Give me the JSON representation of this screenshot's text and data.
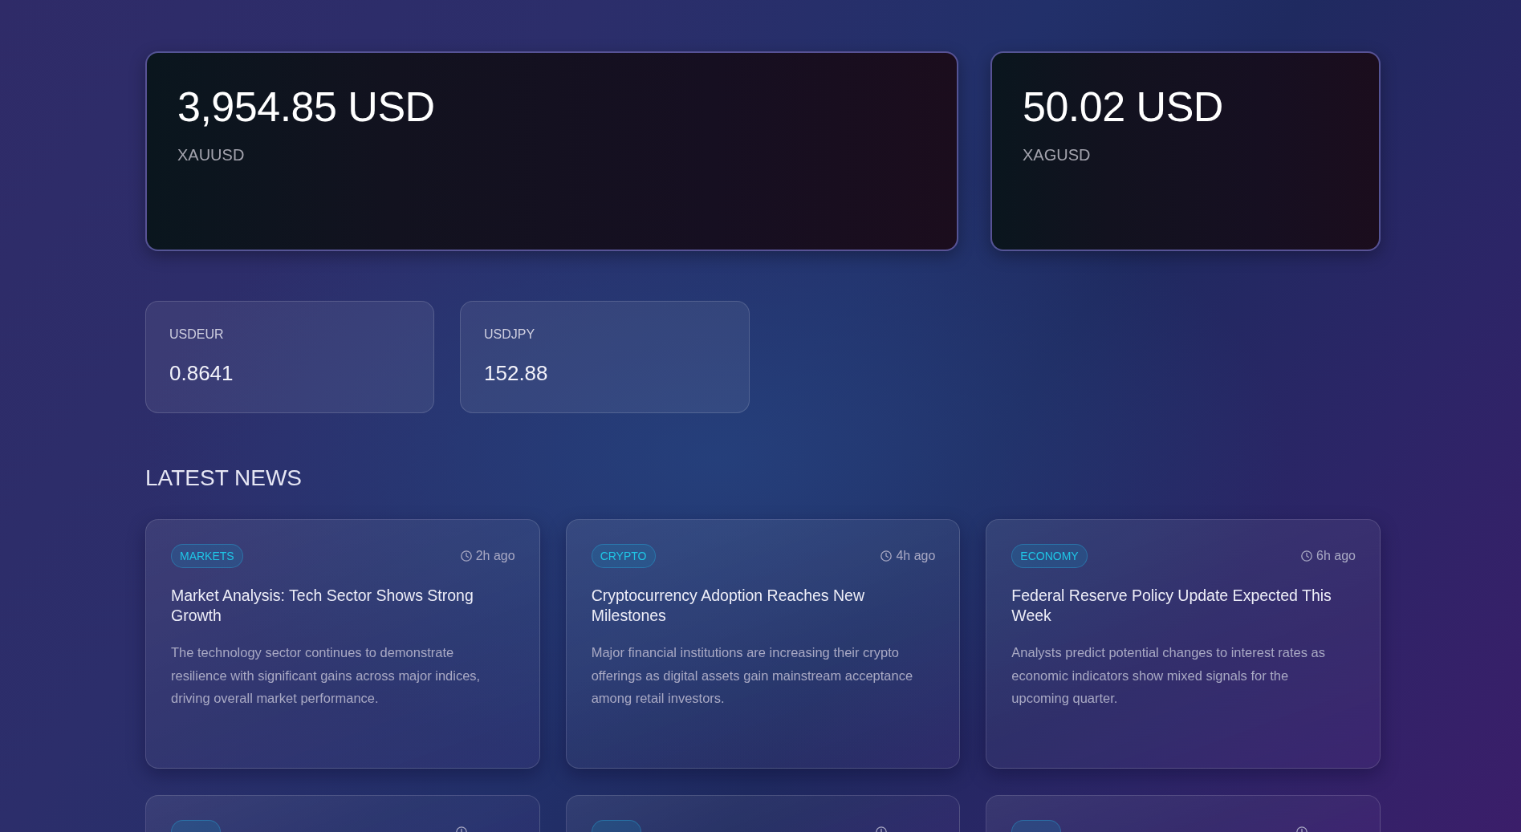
{
  "price_cards": [
    {
      "value": "3,954.85 USD",
      "symbol": "XAUUSD"
    },
    {
      "value": "50.02 USD",
      "symbol": "XAGUSD"
    }
  ],
  "rate_cards": [
    {
      "symbol": "USDEUR",
      "value": "0.8641"
    },
    {
      "symbol": "USDJPY",
      "value": "152.88"
    }
  ],
  "news": {
    "title": "LATEST NEWS",
    "articles": [
      {
        "kind": "full",
        "category": "MARKETS",
        "time": "2h ago",
        "headline": "Market Analysis: Tech Sector Shows Strong Growth",
        "summary": "The technology sector continues to demonstrate resilience with significant gains across major indices, driving overall market performance."
      },
      {
        "kind": "full",
        "category": "CRYPTO",
        "time": "4h ago",
        "headline": "Cryptocurrency Adoption Reaches New Milestones",
        "summary": "Major financial institutions are increasing their crypto offerings as digital assets gain mainstream acceptance among retail investors."
      },
      {
        "kind": "full",
        "category": "ECONOMY",
        "time": "6h ago",
        "headline": "Federal Reserve Policy Update Expected This Week",
        "summary": "Analysts predict potential changes to interest rates as economic indicators show mixed signals for the upcoming quarter."
      },
      {
        "kind": "cut-off"
      },
      {
        "kind": "cut-off"
      },
      {
        "kind": "cut-off"
      }
    ]
  }
}
